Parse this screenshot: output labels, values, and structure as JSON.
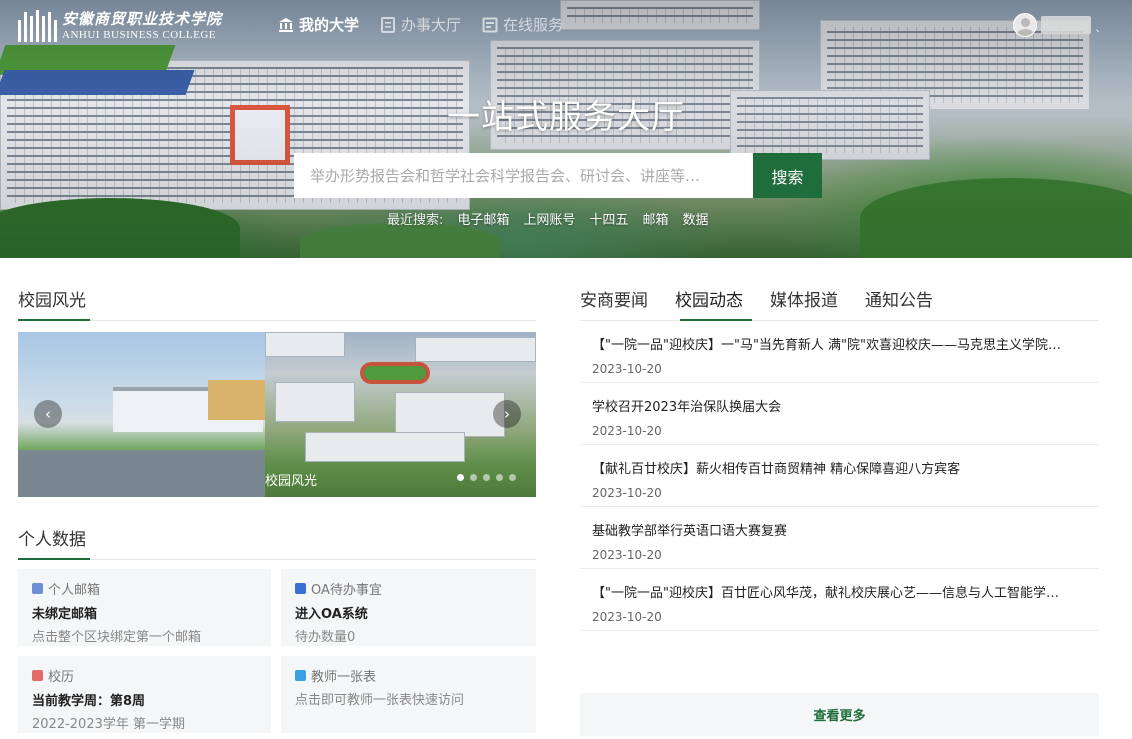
{
  "header": {
    "logo_cn": "安徽商贸职业技术学院",
    "logo_en": "ANHUI BUSINESS COLLEGE",
    "nav": [
      {
        "label": "我的大学",
        "icon": "university-icon",
        "active": true
      },
      {
        "label": "办事大厅",
        "icon": "document-icon",
        "active": false
      },
      {
        "label": "在线服务",
        "icon": "service-icon",
        "active": false
      }
    ],
    "user_caret": "ˎ"
  },
  "hero": {
    "title": "一站式服务大厅",
    "search_placeholder": "举办形势报告会和哲学社会科学报告会、研讨会、讲座等…",
    "search_button": "搜索",
    "recent_label": "最近搜索:",
    "recent": [
      "电子邮箱",
      "上网账号",
      "十四五",
      "邮箱",
      "数据"
    ]
  },
  "scenery": {
    "title": "校园风光",
    "caption": "校园风光",
    "prev": "‹",
    "next": "›",
    "slide_count": 5,
    "active_slide": 1
  },
  "personal": {
    "title": "个人数据",
    "cards": [
      {
        "icon": "mail-icon",
        "icon_color": "#6d8fd6",
        "label": "个人邮箱",
        "main": "未绑定邮箱",
        "sub": "点击整个区块绑定第一个邮箱"
      },
      {
        "icon": "oa-icon",
        "icon_color": "#3b6fd1",
        "label": "OA待办事宜",
        "main": "进入OA系统",
        "sub": "待办数量0"
      },
      {
        "icon": "calendar-icon",
        "icon_color": "#e36a6a",
        "label": "校历",
        "main": "当前教学周：第8周",
        "sub": "2022-2023学年 第一学期"
      },
      {
        "icon": "table-icon",
        "icon_color": "#3aa0e6",
        "label": "教师一张表",
        "main": "",
        "sub": "点击即可教师一张表快速访问"
      }
    ]
  },
  "news": {
    "tabs": [
      "安商要闻",
      "校园动态",
      "媒体报道",
      "通知公告"
    ],
    "active_tab": 1,
    "items": [
      {
        "title": "【\"一院一品\"迎校庆】一\"马\"当先育新人 满\"院\"欢喜迎校庆——马克思主义学院开展系列活动",
        "date": "2023-10-20"
      },
      {
        "title": "学校召开2023年治保队换届大会",
        "date": "2023-10-20"
      },
      {
        "title": "【献礼百廿校庆】薪火相传百廿商贸精神 精心保障喜迎八方宾客",
        "date": "2023-10-20"
      },
      {
        "title": "基础教学部举行英语口语大赛复赛",
        "date": "2023-10-20"
      },
      {
        "title": "【\"一院一品\"迎校庆】百廿匠心风华茂，献礼校庆展心艺——信息与人工智能学院开展系列活动",
        "date": "2023-10-20"
      }
    ],
    "more": "查看更多"
  },
  "colors": {
    "accent": "#1f6d3a"
  }
}
